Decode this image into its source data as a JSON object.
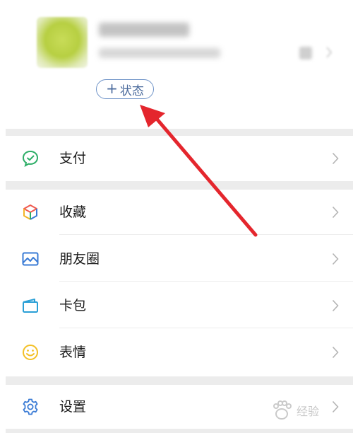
{
  "profile": {
    "status_button": {
      "plus": "+",
      "label": "状态"
    }
  },
  "menu": {
    "pay": {
      "label": "支付",
      "icon": "wechat-pay-icon",
      "color": "#2dae67"
    },
    "favorites": {
      "label": "收藏",
      "icon": "cube-icon"
    },
    "moments": {
      "label": "朋友圈",
      "icon": "picture-icon",
      "color": "#3a7bd5"
    },
    "cards": {
      "label": "卡包",
      "icon": "wallet-icon",
      "color": "#2a9fd6"
    },
    "stickers": {
      "label": "表情",
      "icon": "smiley-icon",
      "color": "#f3c026"
    },
    "settings": {
      "label": "设置",
      "icon": "gear-icon",
      "color": "#3a7bd5"
    }
  },
  "annotation": {
    "color": "#e4262d",
    "icon": "red-arrow-pointer"
  },
  "watermark": {
    "text": "经验"
  },
  "colors": {
    "background": "#ffffff",
    "section_gap": "#ececec",
    "chevron": "#b3b3b3"
  }
}
